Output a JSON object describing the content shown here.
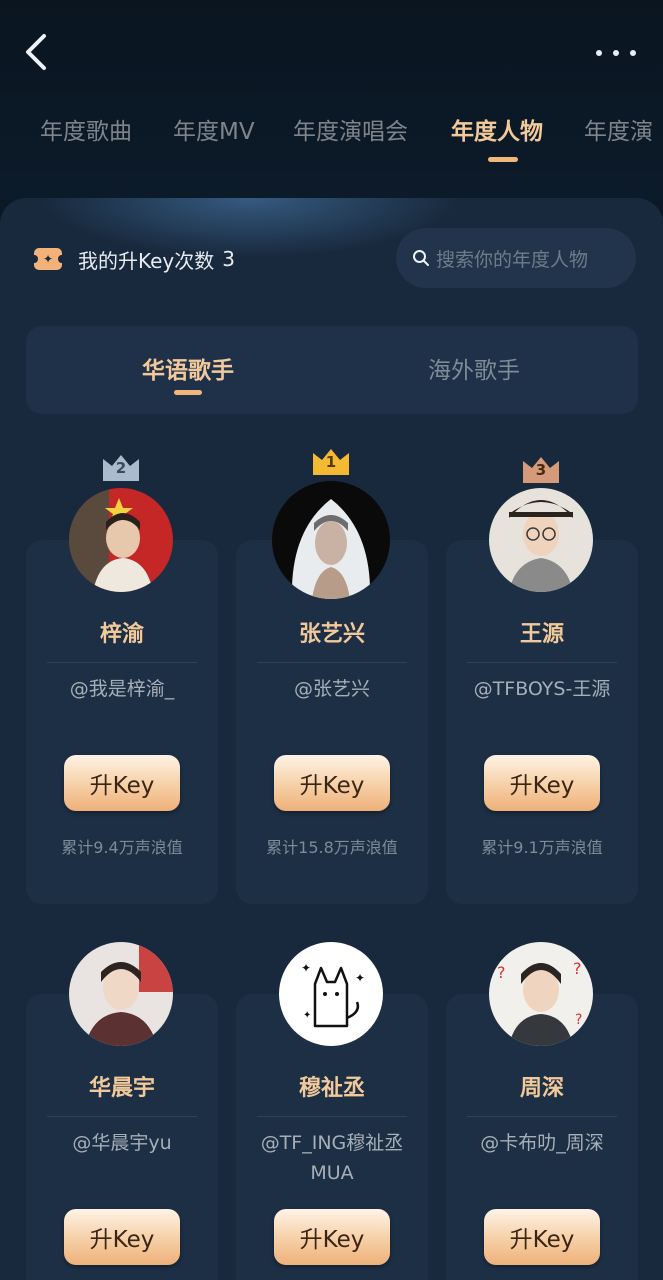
{
  "header": {
    "tabs": [
      {
        "label": "年度歌曲"
      },
      {
        "label": "年度MV"
      },
      {
        "label": "年度演唱会"
      },
      {
        "label": "年度人物"
      },
      {
        "label": "年度演"
      }
    ],
    "active_tab": "年度人物"
  },
  "key_info": {
    "label": "我的升Key次数",
    "count": "3"
  },
  "search": {
    "placeholder": "搜索你的年度人物"
  },
  "segments": {
    "items": [
      "华语歌手",
      "海外歌手"
    ],
    "active": "华语歌手"
  },
  "cards": [
    {
      "rank": "2",
      "name": "梓渝",
      "handle": "@我是梓渝_",
      "button": "升Key",
      "total": "累计9.4万声浪值"
    },
    {
      "rank": "1",
      "name": "张艺兴",
      "handle": "@张艺兴",
      "button": "升Key",
      "total": "累计15.8万声浪值"
    },
    {
      "rank": "3",
      "name": "王源",
      "handle": "@TFBOYS-王源",
      "button": "升Key",
      "total": "累计9.1万声浪值"
    },
    {
      "name": "华晨宇",
      "handle": "@华晨宇yu",
      "button": "升Key"
    },
    {
      "name": "穆祉丞",
      "handle": "@TF_ING穆祉丞MUA",
      "button": "升Key"
    },
    {
      "name": "周深",
      "handle": "@卡布叻_周深",
      "button": "升Key"
    }
  ],
  "colors": {
    "background": "#0c1826",
    "panel": "#18293d",
    "card": "#1d2f45",
    "accent": "#f2c99a",
    "gold_badge": "#f3bb33",
    "silver_badge": "#a9bccd",
    "bronze_badge": "#d59a79"
  },
  "icons": [
    "back-arrow-icon",
    "more-dots-icon",
    "ticket-icon",
    "search-icon",
    "crown-badge-icon"
  ]
}
